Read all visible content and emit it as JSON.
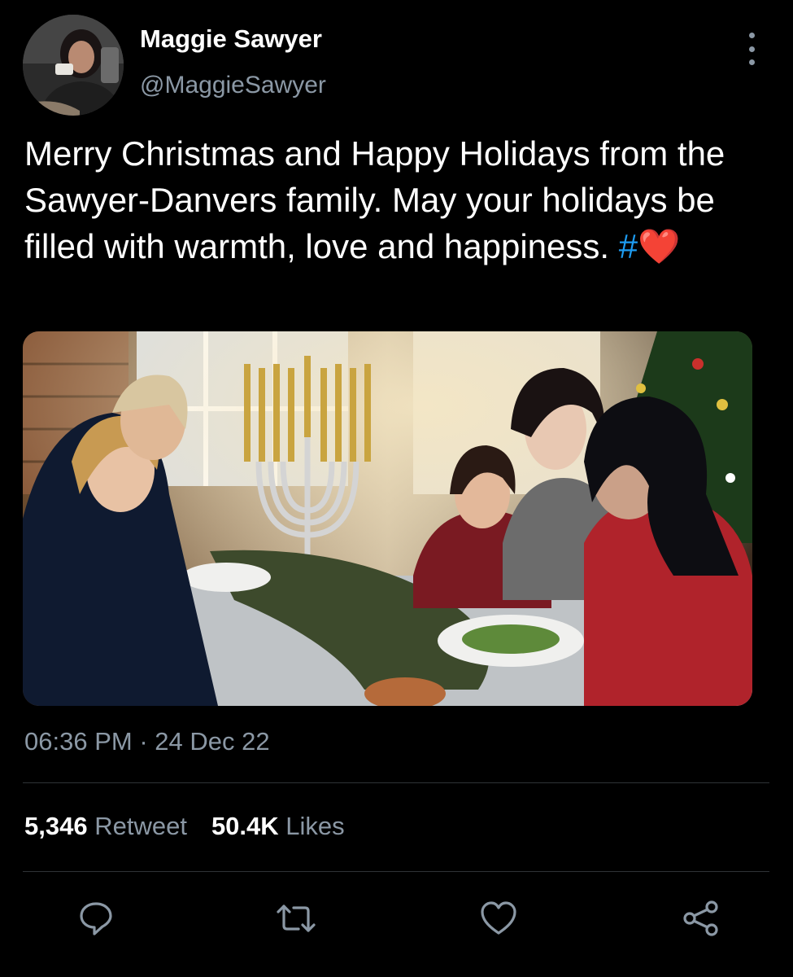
{
  "author": {
    "name": "Maggie Sawyer",
    "handle": "@MaggieSawyer"
  },
  "tweet": {
    "text": "Merry Christmas and Happy Holidays from the Sawyer-Danvers family. May your holidays be filled with warmth, love and happiness. ",
    "hashtag": "#",
    "emoji": "❤️"
  },
  "timestamp": {
    "time": "06:36 PM",
    "separator": "·",
    "date": "24 Dec 22"
  },
  "stats": {
    "retweets_count": "5,346",
    "retweets_label": "Retweet",
    "likes_count": "50.4K",
    "likes_label": "Likes"
  },
  "actions": [
    "reply-icon",
    "retweet-icon",
    "like-icon",
    "share-icon"
  ],
  "colors": {
    "background": "#000000",
    "text": "#ffffff",
    "secondary": "#8b98a5",
    "link": "#1d9bf0",
    "divider": "#2f3336"
  }
}
